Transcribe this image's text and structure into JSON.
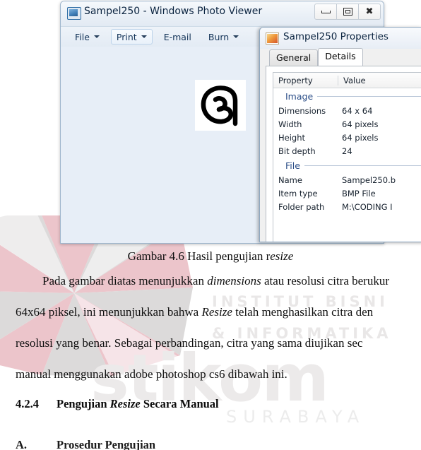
{
  "viewer_window": {
    "title": "Sampel250 - Windows Photo Viewer",
    "icon": "photo-viewer-icon",
    "window_controls": {
      "minimize": "minimize-icon",
      "maximize": "maximize-icon",
      "close": "close-icon"
    },
    "menu": [
      {
        "label": "File",
        "has_caret": true
      },
      {
        "label": "Print",
        "has_caret": true
      },
      {
        "label": "E-mail",
        "has_caret": false
      },
      {
        "label": "Burn",
        "has_caret": true
      }
    ],
    "canvas": {
      "thumbnail_alt": "handwritten-digit-image",
      "background_color": "#e7eef7"
    }
  },
  "properties_dialog": {
    "title": "Sampel250 Properties",
    "icon": "bmp-file-icon",
    "tabs": [
      {
        "label": "General",
        "active": false
      },
      {
        "label": "Details",
        "active": true
      }
    ],
    "columns": {
      "property": "Property",
      "value": "Value"
    },
    "groups": [
      {
        "name": "Image",
        "rows": [
          {
            "property": "Dimensions",
            "value": "64 x 64"
          },
          {
            "property": "Width",
            "value": "64 pixels"
          },
          {
            "property": "Height",
            "value": "64 pixels"
          },
          {
            "property": "Bit depth",
            "value": "24"
          }
        ]
      },
      {
        "name": "File",
        "rows": [
          {
            "property": "Name",
            "value": "Sampel250.b"
          },
          {
            "property": "Item type",
            "value": "BMP File"
          },
          {
            "property": "Folder path",
            "value": "M:\\CODING I"
          }
        ]
      }
    ]
  },
  "document": {
    "caption": {
      "prefix": "Gambar 4.6 Hasil pengujian r",
      "italic": "esize"
    },
    "paragraph": {
      "line1_a": "Pada gambar diatas menunjukkan ",
      "line1_i": "dimensions",
      "line1_b": " atau resolusi citra berukur",
      "line2_a": "64x64 piksel, ini menunjukkan bahwa ",
      "line2_i": "Resize",
      "line2_b": " telah menghasilkan citra den",
      "line3": "resolusi yang benar. Sebagai perbandingan, citra yang sama diujikan sec",
      "line4": "manual menggunakan adobe photoshop cs6 dibawah ini."
    },
    "heading": {
      "number": "4.2.4",
      "text_a": "Pengujian ",
      "text_i": "Resize",
      "text_b": " Secara Manual"
    },
    "subheading": {
      "number": "A.",
      "text": "Prosedur Pengujian"
    },
    "watermark": {
      "brand": "stikom",
      "institute_line1": "INSTITUT BISNI",
      "institute_line2": "& INFORMATIKA",
      "city": "SURABAYA"
    }
  }
}
